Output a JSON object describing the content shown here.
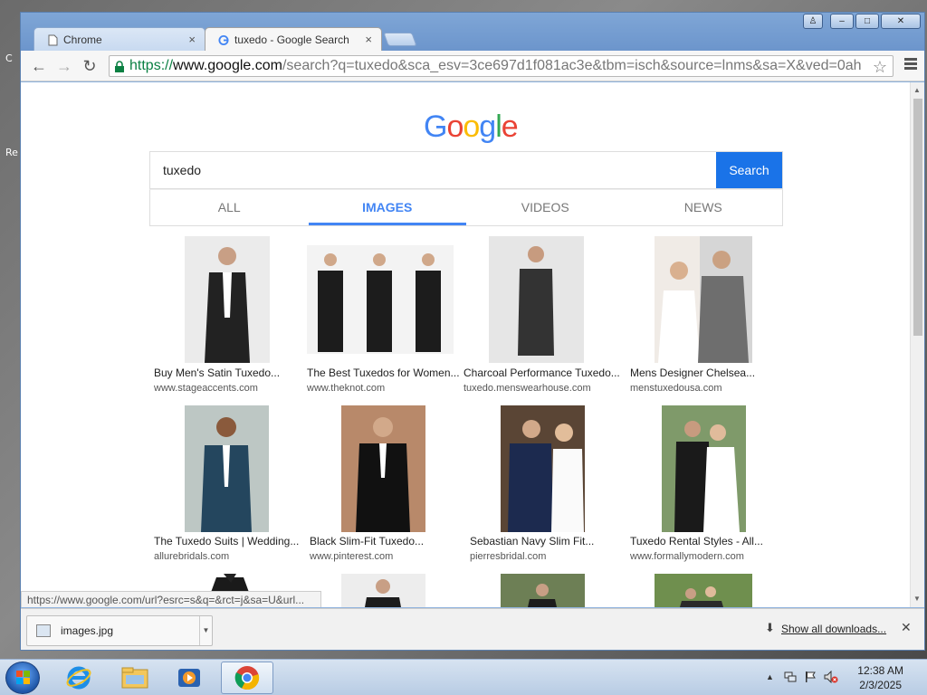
{
  "desktop": {
    "icon_labels": [
      "C",
      "Re"
    ]
  },
  "window": {
    "controls": {
      "account": "♙",
      "minimize": "–",
      "maximize": "□",
      "close": "✕"
    }
  },
  "tabs": [
    {
      "label": "Chrome",
      "close": "×"
    },
    {
      "label": "tuxedo - Google Search",
      "close": "×"
    }
  ],
  "toolbar": {
    "back": "←",
    "forward": "→",
    "reload": "↻",
    "url_scheme": "https://",
    "url_domain": "www.google.com",
    "url_path": "/search?q=tuxedo&sca_esv=3ce697d1f081ac3e&tbm=isch&source=lnms&sa=X&ved=0ah",
    "star": "☆"
  },
  "google": {
    "logo_letters": [
      {
        "ch": "G",
        "color": "#4285f4"
      },
      {
        "ch": "o",
        "color": "#ea4335"
      },
      {
        "ch": "o",
        "color": "#fbbc05"
      },
      {
        "ch": "g",
        "color": "#4285f4"
      },
      {
        "ch": "l",
        "color": "#34a853"
      },
      {
        "ch": "e",
        "color": "#ea4335"
      }
    ],
    "query": "tuxedo",
    "search_button": "Search",
    "tabs": [
      "ALL",
      "IMAGES",
      "VIDEOS",
      "NEWS"
    ],
    "selected_tab": "IMAGES"
  },
  "results": [
    {
      "title": "Buy Men's Satin Tuxedo...",
      "source": "www.stageaccents.com"
    },
    {
      "title": "The Best Tuxedos for Women...",
      "source": "www.theknot.com"
    },
    {
      "title": "Charcoal Performance Tuxedo...",
      "source": "tuxedo.menswearhouse.com"
    },
    {
      "title": "Mens Designer Chelsea...",
      "source": "menstuxedousa.com"
    },
    {
      "title": "The Tuxedo Suits | Wedding...",
      "source": "allurebridals.com"
    },
    {
      "title": "Black Slim-Fit Tuxedo...",
      "source": "www.pinterest.com"
    },
    {
      "title": "Sebastian Navy Slim Fit...",
      "source": "pierresbridal.com"
    },
    {
      "title": "Tuxedo Rental Styles - All...",
      "source": "www.formallymodern.com"
    }
  ],
  "status_url": "https://www.google.com/url?esrc=s&q=&rct=j&sa=U&url...",
  "downloads": {
    "file_name": "images.jpg",
    "show_all": "Show all downloads...",
    "close": "✕"
  },
  "taskbar": {
    "time": "12:38 AM",
    "date": "2/3/2025"
  },
  "colors": {
    "accent": "#1a73e8",
    "tab_selected": "#4285f4",
    "url_secure": "#0b8043"
  }
}
